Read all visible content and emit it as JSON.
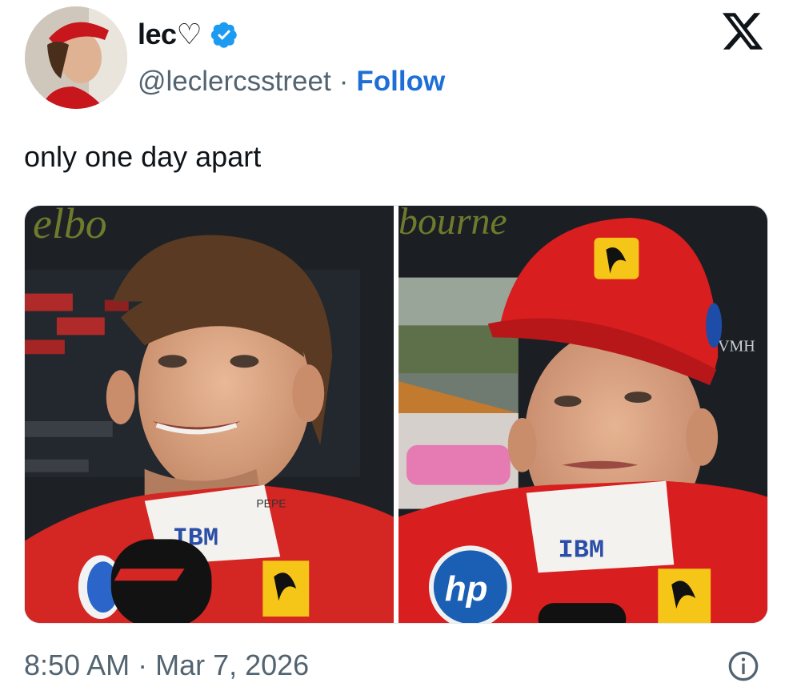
{
  "author": {
    "display_name": "lec♡",
    "handle": "@leclercsstreet",
    "separator": "·",
    "follow_label": "Follow",
    "verified_icon": "verified-badge-icon"
  },
  "platform_icon": "x-logo-icon",
  "tweet": {
    "text": "only one day apart",
    "timestamp": "8:50 AM · Mar 7, 2026"
  },
  "media": {
    "left_photo": {
      "background_text": "elbo",
      "collar_text": "IBM",
      "collar_side_text": "PEPE"
    },
    "right_photo": {
      "background_text": "bourne",
      "collar_text": "IBM",
      "chest_logo_text": "hp",
      "side_text": "VMH"
    }
  },
  "colors": {
    "accent": "#1d6fd6",
    "verified": "#1d9bf0",
    "ferrari_red": "#d81e1e",
    "text_secondary": "#536471"
  },
  "info_icon": "info-icon"
}
